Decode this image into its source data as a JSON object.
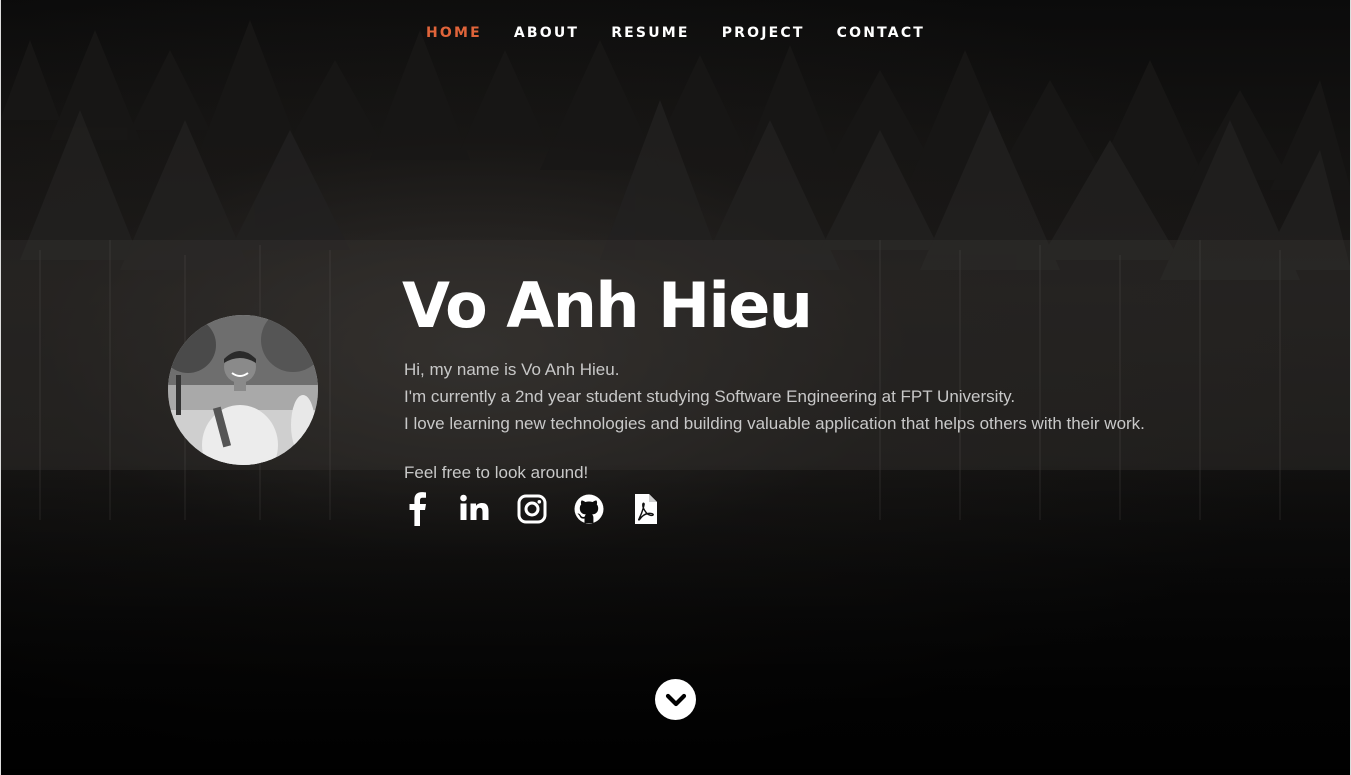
{
  "nav": {
    "items": [
      {
        "label": "HOME",
        "active": true
      },
      {
        "label": "ABOUT",
        "active": false
      },
      {
        "label": "RESUME",
        "active": false
      },
      {
        "label": "PROJECT",
        "active": false
      },
      {
        "label": "CONTACT",
        "active": false
      }
    ],
    "active_color": "#e0643a"
  },
  "hero": {
    "name": "Vo Anh Hieu",
    "bio": [
      "Hi, my name is Vo Anh Hieu.",
      "I'm currently a 2nd year student studying Software Engineering at FPT University.",
      "I love learning new technologies and building valuable application that helps others with their work."
    ],
    "cta": "Feel free to look around!",
    "social": [
      {
        "icon": "facebook-icon"
      },
      {
        "icon": "linkedin-icon"
      },
      {
        "icon": "instagram-icon"
      },
      {
        "icon": "github-icon"
      },
      {
        "icon": "pdf-icon"
      }
    ],
    "scroll_icon": "chevron-down-icon"
  }
}
